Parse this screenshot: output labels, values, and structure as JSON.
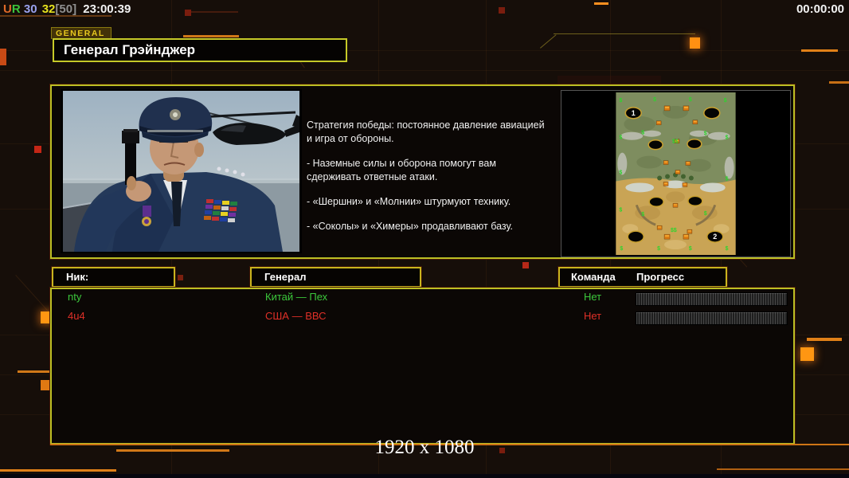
{
  "top_bar": {
    "tokens": [
      {
        "text": "U",
        "color": "#e06a28"
      },
      {
        "text": "R",
        "color": "#3cc43c"
      },
      {
        "text": "30",
        "color": "#9aa2ee"
      },
      {
        "text": "32",
        "color": "#e6e21e"
      },
      {
        "text": "[50]",
        "color": "#8f8f8f"
      },
      {
        "text": "23:00:39",
        "color": "#f2f2f2"
      }
    ],
    "match_timer": "00:00:00"
  },
  "general_panel": {
    "tab_label": "GENERAL",
    "general_name": "Генерал Грэйнджер",
    "strategy_paragraphs": [
      "Стратегия победы: постоянное давление авиацией\n и игра от обороны.",
      "- Наземные силы и оборона помогут вам\n сдерживать ответные атаки.",
      "- «Шершни» и «Молнии» штурмуют технику.",
      "- «Соколы» и «Химеры» продавливают базу."
    ],
    "map_preview": {
      "start_marker_1": "1",
      "start_marker_2": "2"
    }
  },
  "lobby": {
    "headers": {
      "nick": "Ник:",
      "general": "Генерал",
      "team": "Команда",
      "progress": "Прогресс"
    },
    "players": [
      {
        "nick": "nty",
        "general": "Китай — Пех",
        "team": "Нет",
        "color": "#3cc83c",
        "progress_percent": 0
      },
      {
        "nick": "4u4",
        "general": "США — ВВС",
        "team": "Нет",
        "color": "#e03028",
        "progress_percent": 0
      }
    ]
  },
  "footer": {
    "resolution_label": "1920 x 1080"
  },
  "colors": {
    "panel_border": "#bcbf24",
    "accent_orange": "#e07818",
    "background": "#160e09"
  }
}
